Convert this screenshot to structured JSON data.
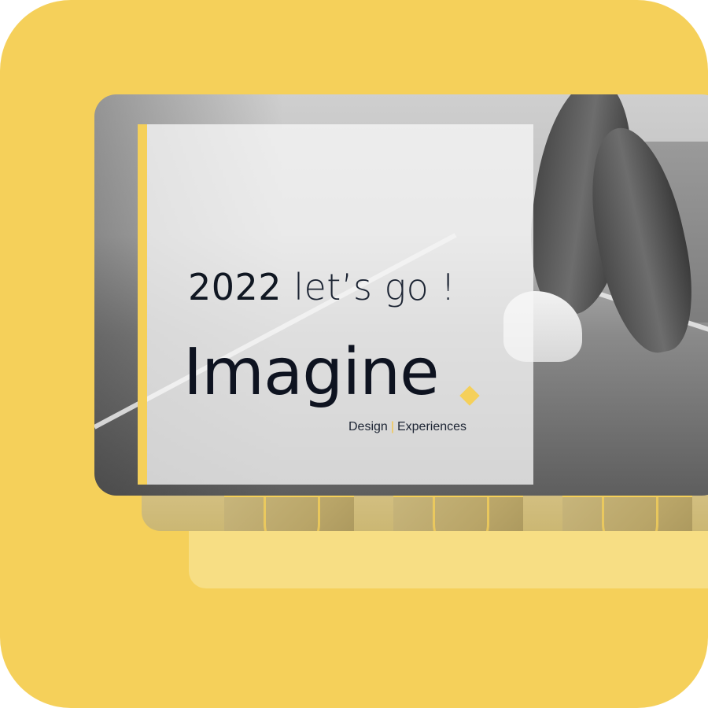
{
  "colors": {
    "background": "#f5d05a",
    "accent": "#f5d05a",
    "text_dark": "#101722"
  },
  "card": {
    "headline_year": "2022",
    "headline_rest": "let’s go !",
    "brand_name": "Imagine",
    "tagline_left": "Design",
    "tagline_separator": "|",
    "tagline_right": "Experiences"
  },
  "icons": {
    "brand_mark": "diamond-icon"
  }
}
